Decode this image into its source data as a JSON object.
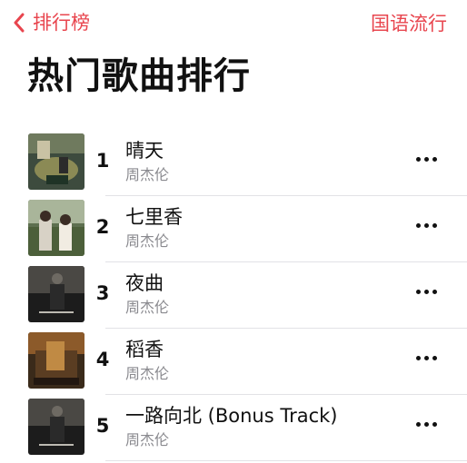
{
  "nav": {
    "back_label": "排行榜",
    "genre_label": "国语流行"
  },
  "page_title": "热门歌曲排行",
  "songs": [
    {
      "rank": "1",
      "title": "晴天",
      "artist": "周杰伦"
    },
    {
      "rank": "2",
      "title": "七里香",
      "artist": "周杰伦"
    },
    {
      "rank": "3",
      "title": "夜曲",
      "artist": "周杰伦"
    },
    {
      "rank": "4",
      "title": "稻香",
      "artist": "周杰伦"
    },
    {
      "rank": "5",
      "title": "一路向北 (Bonus Track)",
      "artist": "周杰伦"
    }
  ],
  "icons": {
    "back": "chevron-left-icon",
    "more": "more-horizontal-icon"
  },
  "colors": {
    "accent": "#e8454e",
    "secondary_text": "#8a8a8f",
    "separator": "#e2e2e6"
  }
}
